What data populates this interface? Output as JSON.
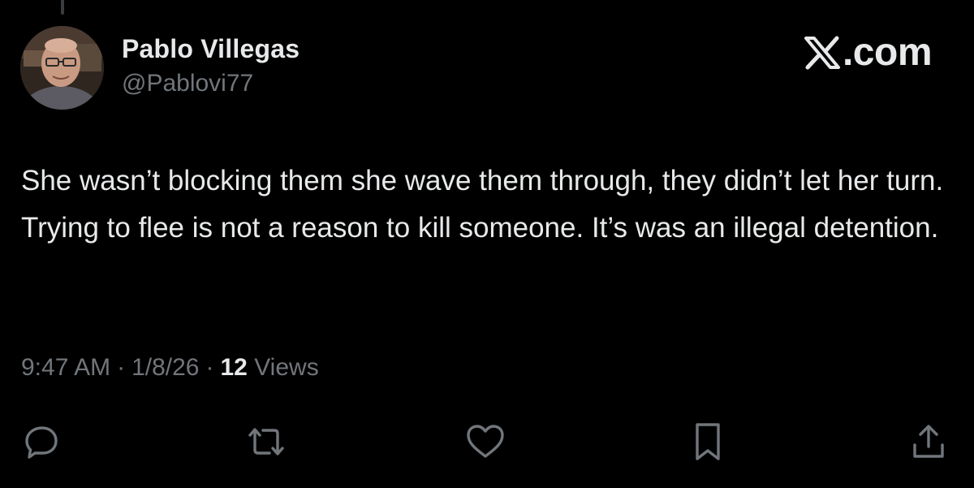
{
  "post": {
    "author_name": "Pablo Villegas",
    "author_handle": "@Pablovi77",
    "brand": ".com",
    "text": "She wasn’t blocking them she wave them through, they didn’t let her turn. Trying to flee is not a reason to kill someone. It’s was an illegal detention.",
    "time": "9:47 AM",
    "date": "1/8/26",
    "separator": "·",
    "views_count": "12",
    "views_label": "Views"
  },
  "actions": [
    {
      "name": "reply",
      "icon": "reply-icon"
    },
    {
      "name": "repost",
      "icon": "repost-icon"
    },
    {
      "name": "like",
      "icon": "heart-icon"
    },
    {
      "name": "bookmark",
      "icon": "bookmark-icon"
    },
    {
      "name": "share",
      "icon": "share-icon"
    }
  ],
  "colors": {
    "background": "#000000",
    "primary_text": "#e7e9ea",
    "secondary_text": "#71767b"
  }
}
